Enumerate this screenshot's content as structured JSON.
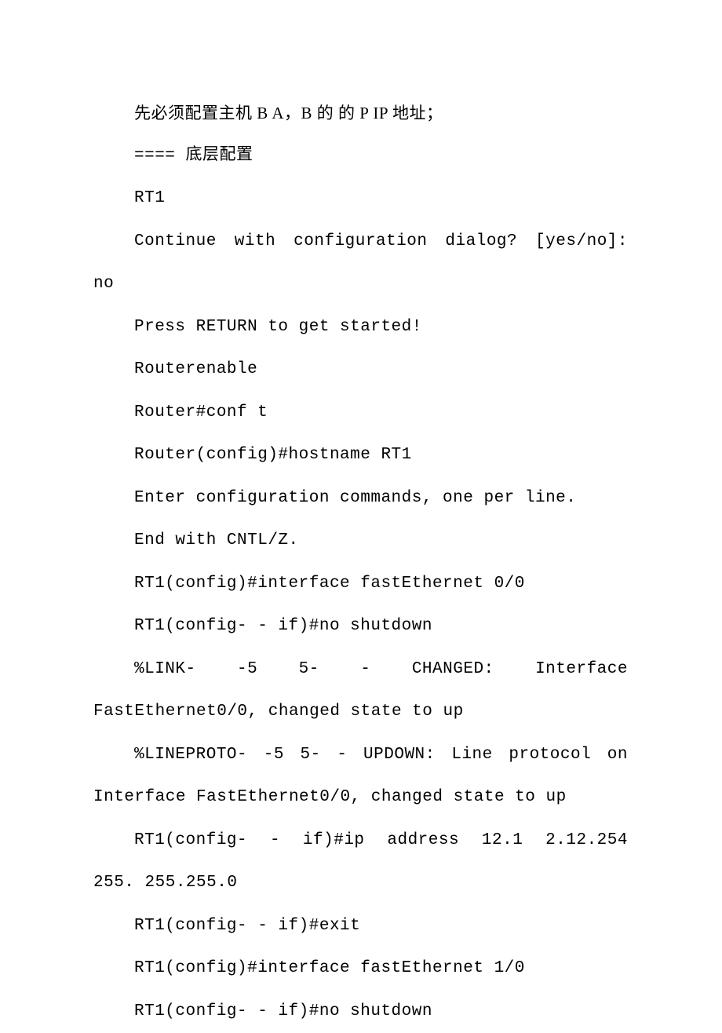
{
  "lines": {
    "l1": "先必须配置主机 B A，B 的 的 P IP 地址；",
    "l2": "==== 底层配置",
    "l3": "RT1",
    "l4": " Continue  with  configuration  dialog?  [yes/no]:",
    "l5": "no",
    "l6": "Press RETURN to get started!",
    "l7": "Routerenable",
    "l8": "Router#conf t",
    "l9": "Router(config)#hostname RT1",
    "l10": "Enter configuration commands, one per line.",
    "l11": "End with CNTL/Z.",
    "l12": "RT1(config)#interface fastEthernet 0/0",
    "l13": "RT1(config- - if)#no shutdown",
    "l14": "   %LINK-   -5   5-   -   CHANGED:    Interface",
    "l15": "FastEthernet0/0, changed state to up",
    "l16": " %LINEPROTO- -5 5- - UPDOWN: Line protocol  on",
    "l17": "Interface FastEthernet0/0, changed state to up",
    "l18": " RT1(config-  -  if)#ip  address  12.1  2.12.254",
    "l19": "255. 255.255.0",
    "l20": "RT1(config- - if)#exit",
    "l21": "RT1(config)#interface fastEthernet 1/0",
    "l22": "RT1(config- - if)#no shutdown"
  }
}
